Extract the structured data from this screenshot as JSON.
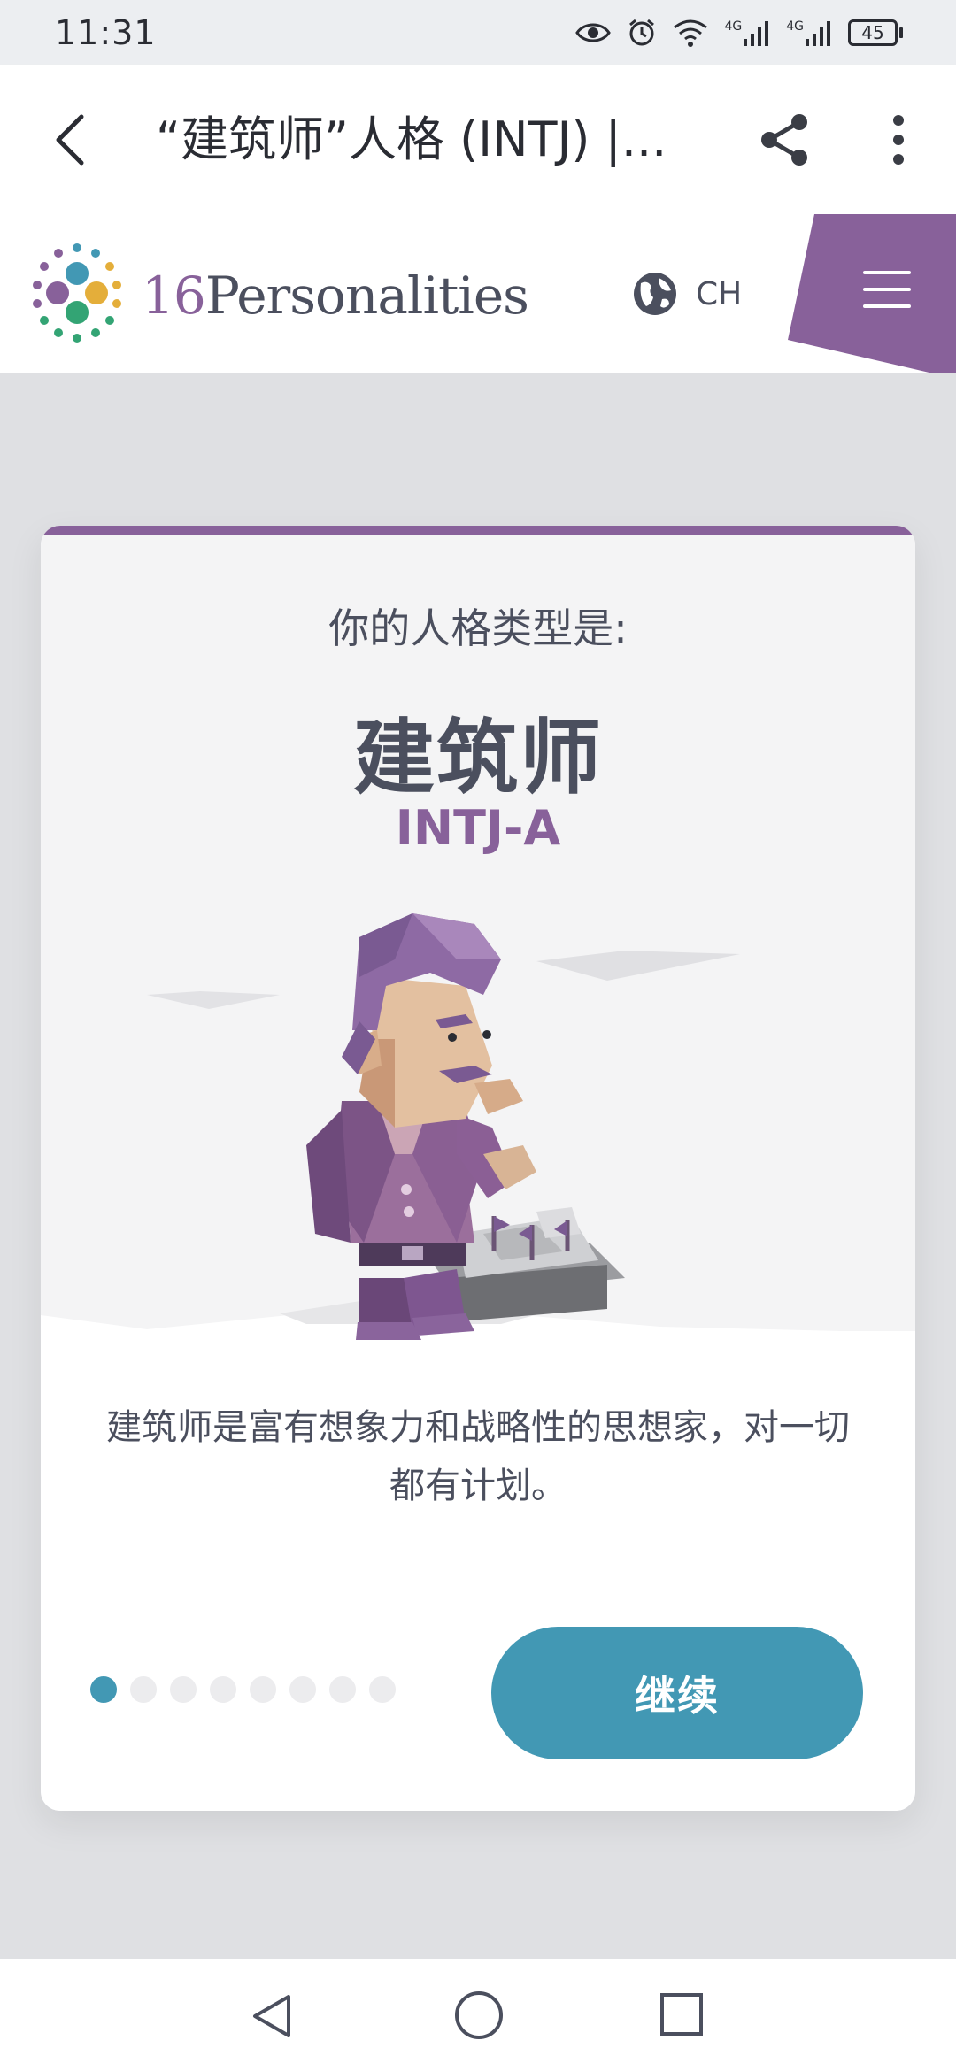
{
  "status_bar": {
    "time": "11:31",
    "signal_labels": [
      "4G",
      "4G"
    ],
    "battery": "45"
  },
  "browser": {
    "page_title": "“建筑师”人格 (INTJ) |...",
    "icons": [
      "back-arrow-icon",
      "share-icon",
      "more-vertical-icon"
    ]
  },
  "site_header": {
    "logo_number": "16",
    "logo_name": "Personalities",
    "language": "CH",
    "colors": {
      "accent_purple": "#88619a",
      "accent_blue": "#4298b4",
      "accent_green": "#33a474",
      "accent_yellow": "#e4ae3a"
    }
  },
  "card": {
    "result_label": "你的人格类型是:",
    "type_name": "建筑师",
    "type_code": "INTJ-A",
    "description": "建筑师是富有想象力和战略性的思想家，对一切都有计划。",
    "pager": {
      "total": 8,
      "current": 1
    },
    "continue_label": "继续"
  },
  "nav_bar": {
    "icons": [
      "nav-back-icon",
      "nav-home-icon",
      "nav-recent-icon"
    ]
  }
}
